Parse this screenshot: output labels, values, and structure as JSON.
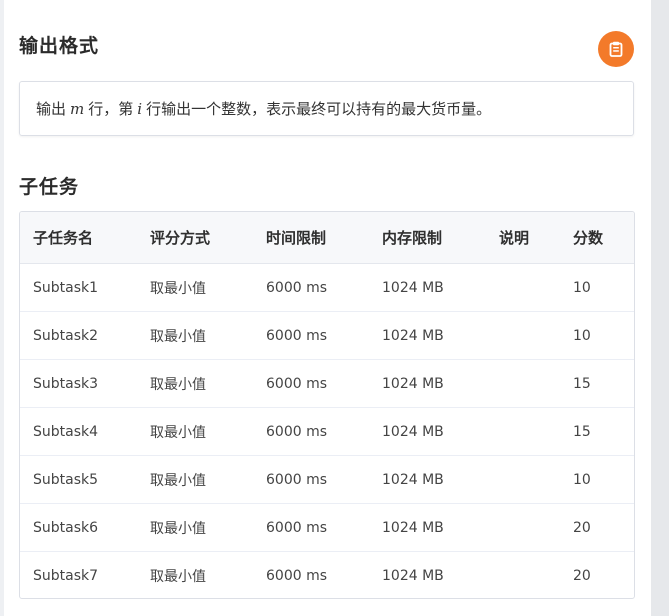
{
  "output_format": {
    "title": "输出格式",
    "text_before": "输出",
    "var_m": "m",
    "text_middle": "行，第",
    "var_i": "i",
    "text_after": "行输出一个整数，表示最终可以持有的最大货币量。"
  },
  "copy_button": {
    "icon": "clipboard-icon",
    "color": "#f37a2a"
  },
  "subtasks": {
    "title": "子任务",
    "headers": [
      "子任务名",
      "评分方式",
      "时间限制",
      "内存限制",
      "说明",
      "分数"
    ],
    "rows": [
      [
        "Subtask1",
        "取最小值",
        "6000 ms",
        "1024 MB",
        "",
        "10"
      ],
      [
        "Subtask2",
        "取最小值",
        "6000 ms",
        "1024 MB",
        "",
        "10"
      ],
      [
        "Subtask3",
        "取最小值",
        "6000 ms",
        "1024 MB",
        "",
        "15"
      ],
      [
        "Subtask4",
        "取最小值",
        "6000 ms",
        "1024 MB",
        "",
        "15"
      ],
      [
        "Subtask5",
        "取最小值",
        "6000 ms",
        "1024 MB",
        "",
        "10"
      ],
      [
        "Subtask6",
        "取最小值",
        "6000 ms",
        "1024 MB",
        "",
        "20"
      ],
      [
        "Subtask7",
        "取最小值",
        "6000 ms",
        "1024 MB",
        "",
        "20"
      ]
    ]
  }
}
